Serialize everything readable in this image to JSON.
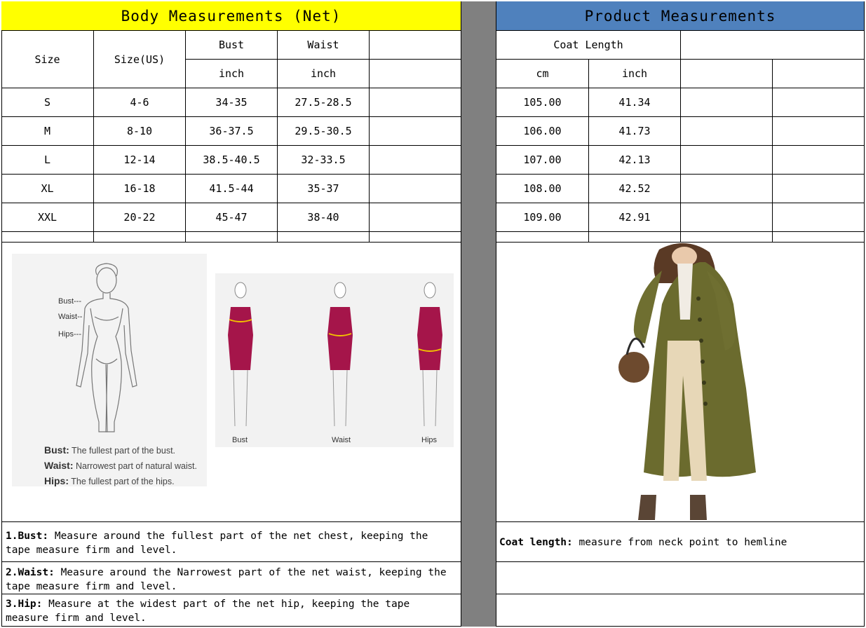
{
  "left_header": "Body Measurements (Net)",
  "right_header": "Product Measurements",
  "colors": {
    "yellow": "#FFFF00",
    "blue": "#4F81BD",
    "divider": "#808080",
    "dress": "#A5154A",
    "coat": "#6B6B2E"
  },
  "body_table": {
    "col_size": "Size",
    "col_size_us": "Size(US)",
    "col_bust": "Bust",
    "col_waist": "Waist",
    "unit_bust": "inch",
    "unit_waist": "inch",
    "rows": [
      {
        "size": "S",
        "us": "4-6",
        "bust": "34-35",
        "waist": "27.5-28.5"
      },
      {
        "size": "M",
        "us": "8-10",
        "bust": "36-37.5",
        "waist": "29.5-30.5"
      },
      {
        "size": "L",
        "us": "12-14",
        "bust": "38.5-40.5",
        "waist": "32-33.5"
      },
      {
        "size": "XL",
        "us": "16-18",
        "bust": "41.5-44",
        "waist": "35-37"
      },
      {
        "size": "XXL",
        "us": "20-22",
        "bust": "45-47",
        "waist": "38-40"
      }
    ]
  },
  "product_table": {
    "col_coat_length": "Coat Length",
    "unit_cm": "cm",
    "unit_inch": "inch",
    "rows": [
      {
        "cm": "105.00",
        "inch": "41.34"
      },
      {
        "cm": "106.00",
        "inch": "41.73"
      },
      {
        "cm": "107.00",
        "inch": "42.13"
      },
      {
        "cm": "108.00",
        "inch": "42.52"
      },
      {
        "cm": "109.00",
        "inch": "42.91"
      }
    ]
  },
  "figure": {
    "marker_bust": "Bust---",
    "marker_waist": "Waist--",
    "marker_hips": "Hips---",
    "def_bust_label": "Bust:",
    "def_bust_text": "The fullest part of the bust.",
    "def_waist_label": "Waist:",
    "def_waist_text": "Narrowest part of natural waist.",
    "def_hips_label": "Hips:",
    "def_hips_text": "The fullest part of the hips.",
    "dress_labels": [
      "Bust",
      "Waist",
      "Hips"
    ]
  },
  "notes": {
    "bust_label": "1.Bust:",
    "bust_text": "Measure around the fullest part of the net chest, keeping the tape  measure firm and level.",
    "waist_label": "2.Waist:",
    "waist_text": "Measure around the Narrowest part of the net waist, keeping the tape  measure firm and level.",
    "hip_label": "3.Hip:",
    "hip_text": "Measure at the widest part of the net hip, keeping the tape measure firm and level.",
    "coat_label": "Coat length:",
    "coat_text": "measure from neck point to hemline"
  }
}
